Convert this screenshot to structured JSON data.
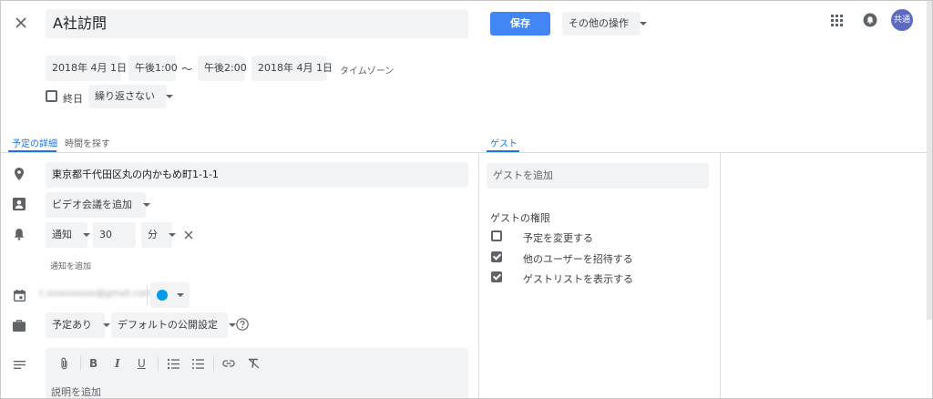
{
  "header": {
    "title": "A社訪問",
    "save_label": "保存",
    "more_actions_label": "その他の操作",
    "avatar_text": "共通"
  },
  "time": {
    "start_date": "2018年 4月 1日",
    "start_time": "午後1:00",
    "separator": "〜",
    "end_time": "午後2:00",
    "end_date": "2018年 4月 1日",
    "timezone_label": "タイムゾーン",
    "all_day_label": "終日",
    "repeat_label": "繰り返さない"
  },
  "tabs": {
    "details": "予定の詳細",
    "find_time": "時間を探す",
    "guests": "ゲスト"
  },
  "details": {
    "location": "東京都千代田区丸の内かもめ町1-1-1",
    "video_conf": "ビデオ会議を追加",
    "notify_type": "通知",
    "notify_value": "30",
    "notify_unit": "分",
    "add_notification": "通知を追加",
    "calendar_email": "c.xxxxxxxxx@gmail.com",
    "calendar_color": "#039be5",
    "availability": "予定あり",
    "visibility": "デフォルトの公開設定",
    "description_placeholder": "説明を追加"
  },
  "guests": {
    "add_placeholder": "ゲストを追加",
    "permissions_title": "ゲストの権限",
    "permissions": [
      {
        "label": "予定を変更する",
        "checked": false
      },
      {
        "label": "他のユーザーを招待する",
        "checked": true
      },
      {
        "label": "ゲストリストを表示する",
        "checked": true
      }
    ]
  },
  "colors": {
    "accent": "#1a73e8",
    "save_button": "#4285f4",
    "avatar": "#5c6bc0"
  }
}
